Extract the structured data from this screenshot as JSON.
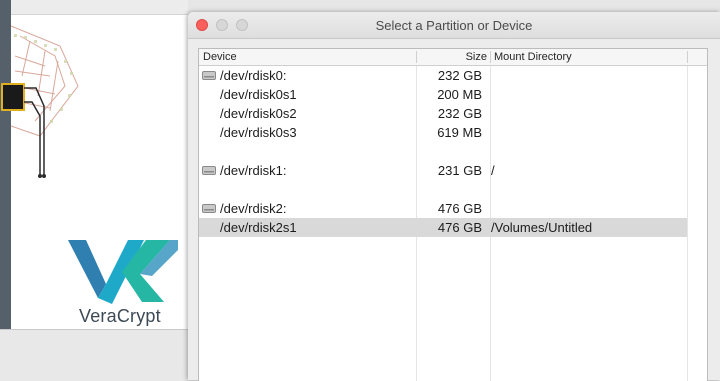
{
  "background_app": {
    "brand_name": "VeraCrypt"
  },
  "dialog": {
    "title": "Select a Partition or Device",
    "columns": {
      "device": "Device",
      "size": "Size",
      "mount": "Mount Directory"
    },
    "rows": [
      {
        "device": "/dev/rdisk0:",
        "size": "232 GB",
        "mount": "",
        "is_disk": true,
        "selected": false
      },
      {
        "device": "/dev/rdisk0s1",
        "size": "200 MB",
        "mount": "",
        "is_disk": false,
        "selected": false
      },
      {
        "device": "/dev/rdisk0s2",
        "size": "232 GB",
        "mount": "",
        "is_disk": false,
        "selected": false
      },
      {
        "device": "/dev/rdisk0s3",
        "size": "619 MB",
        "mount": "",
        "is_disk": false,
        "selected": false
      },
      {
        "device": "/dev/rdisk1:",
        "size": "231 GB",
        "mount": "/",
        "is_disk": true,
        "selected": false
      },
      {
        "device": "/dev/rdisk2:",
        "size": "476 GB",
        "mount": "",
        "is_disk": true,
        "selected": false
      },
      {
        "device": "/dev/rdisk2s1",
        "size": "476 GB",
        "mount": "/Volumes/Untitled",
        "is_disk": false,
        "selected": true
      }
    ],
    "icons": {
      "disk": "hard-disk-icon"
    },
    "colors": {
      "close": "#fc605c",
      "selected_row": "#d9d9d9"
    }
  }
}
